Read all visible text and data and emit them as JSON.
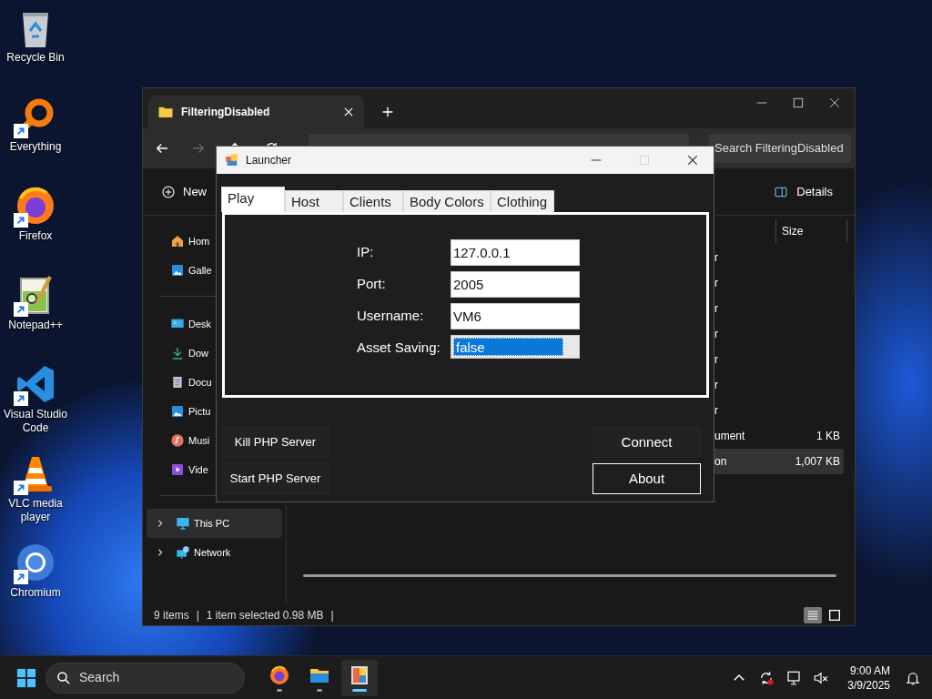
{
  "desktop_icons": [
    {
      "label": "Recycle Bin",
      "kind": "recycle",
      "shortcut": false
    },
    {
      "label": "Everything",
      "kind": "everything",
      "shortcut": true
    },
    {
      "label": "Firefox",
      "kind": "firefox",
      "shortcut": true
    },
    {
      "label": "Notepad++",
      "kind": "notepad",
      "shortcut": true
    },
    {
      "label": "Visual Studio Code",
      "kind": "vscode",
      "shortcut": true
    },
    {
      "label": "VLC media player",
      "kind": "vlc",
      "shortcut": true
    },
    {
      "label": "Chromium",
      "kind": "chromium",
      "shortcut": true
    }
  ],
  "explorer": {
    "tab_title": "FilteringDisabled",
    "nav_buttons": [
      {
        "kind": "back",
        "disabled": false
      },
      {
        "kind": "forward",
        "disabled": true
      },
      {
        "kind": "up",
        "disabled": false
      },
      {
        "kind": "refresh",
        "disabled": false
      }
    ],
    "search_placeholder": "Search FilteringDisabled",
    "new_label": "New",
    "details_label": "Details",
    "nav_groups": [
      [
        {
          "label": "Hom",
          "kind": "home",
          "selected": false
        },
        {
          "label": "Galle",
          "kind": "gallery",
          "selected": false
        }
      ],
      [
        {
          "label": "Desk",
          "kind": "desktop",
          "selected": false
        },
        {
          "label": "Dow",
          "kind": "download",
          "selected": false
        },
        {
          "label": "Docu",
          "kind": "document",
          "selected": false
        },
        {
          "label": "Pictu",
          "kind": "pictures",
          "selected": false
        },
        {
          "label": "Musi",
          "kind": "music",
          "selected": false
        },
        {
          "label": "Vide",
          "kind": "videos",
          "selected": false
        }
      ],
      [
        {
          "label": "This PC",
          "kind": "pc",
          "selected": true
        },
        {
          "label": "Network",
          "kind": "network",
          "selected": false
        }
      ]
    ],
    "size_header": "Size",
    "rows": [
      {
        "type": "r",
        "selected": false
      },
      {
        "type": "r",
        "selected": false
      },
      {
        "type": "r",
        "selected": false
      },
      {
        "type": "r",
        "selected": false
      },
      {
        "type": "r",
        "selected": false
      },
      {
        "type": "r",
        "selected": false
      },
      {
        "type": "r",
        "selected": false
      },
      {
        "type": "ument",
        "size": "1 KB",
        "selected": false
      },
      {
        "type": "on",
        "size": "1,007 KB",
        "selected": true
      }
    ],
    "status": [
      "9 items",
      "|",
      "1 item selected  0.98 MB",
      "|"
    ],
    "views": [
      {
        "kind": "details",
        "selected": true
      },
      {
        "kind": "tiles",
        "selected": false
      }
    ]
  },
  "launcher": {
    "title": "Launcher",
    "tabs": [
      {
        "label": "Play",
        "selected": true
      },
      {
        "label": "Host",
        "selected": false
      },
      {
        "label": "Clients",
        "selected": false
      },
      {
        "label": "Body Colors",
        "selected": false
      },
      {
        "label": "Clothing",
        "selected": false
      }
    ],
    "fields": [
      {
        "label": "IP:",
        "value": "127.0.0.1",
        "kind": "text"
      },
      {
        "label": "Port:",
        "value": "2005",
        "kind": "text"
      },
      {
        "label": "Username:",
        "value": "VM6",
        "kind": "text"
      },
      {
        "label": "Asset Saving:",
        "value": "false",
        "kind": "dropdown",
        "selected": true
      }
    ],
    "left_buttons": [
      "Kill PHP Server",
      "Start PHP Server"
    ],
    "right_buttons": [
      {
        "label": "Connect",
        "focused": false
      },
      {
        "label": "About",
        "focused": true
      }
    ]
  },
  "taskbar": {
    "search_placeholder": "Search",
    "apps": [
      {
        "kind": "firefox",
        "active": false
      },
      {
        "kind": "explorer",
        "active": false
      },
      {
        "kind": "launcher",
        "active": true
      }
    ],
    "tray": [
      {
        "kind": "chevron"
      },
      {
        "kind": "sync"
      },
      {
        "kind": "network"
      },
      {
        "kind": "volume"
      }
    ],
    "time": "9:00 AM",
    "date": "3/9/2025"
  }
}
